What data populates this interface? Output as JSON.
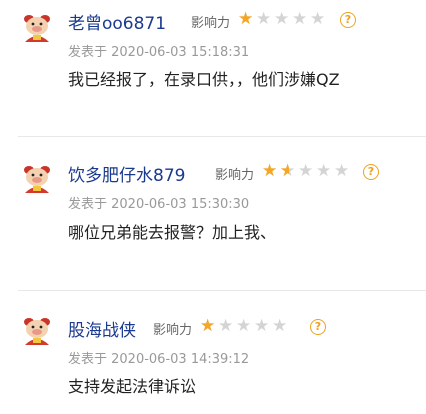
{
  "comments": [
    {
      "username": "老曾oo6871",
      "influence_label": "影响力",
      "rating": 1,
      "rating_max": 5,
      "help_glyph": "?",
      "date": "发表于 2020-06-03 15:18:31",
      "text": "我已经报了，在录口供，，他们涉嫌QZ"
    },
    {
      "username": "饮多肥仔水879",
      "influence_label": "影响力",
      "rating": 1.5,
      "rating_max": 5,
      "help_glyph": "?",
      "date": "发表于 2020-06-03 15:30:30",
      "text": "哪位兄弟能去报警？加上我、"
    },
    {
      "username": "股海战侠",
      "influence_label": "影响力",
      "rating": 1,
      "rating_max": 5,
      "help_glyph": "?",
      "date": "发表于 2020-06-03 14:39:12",
      "text": "支持发起法律诉讼"
    }
  ],
  "colors": {
    "username": "#1a3a8f",
    "star_filled": "#f5a623",
    "star_empty": "#d4d4d4",
    "help_icon": "#f0a020",
    "date": "#999999"
  }
}
